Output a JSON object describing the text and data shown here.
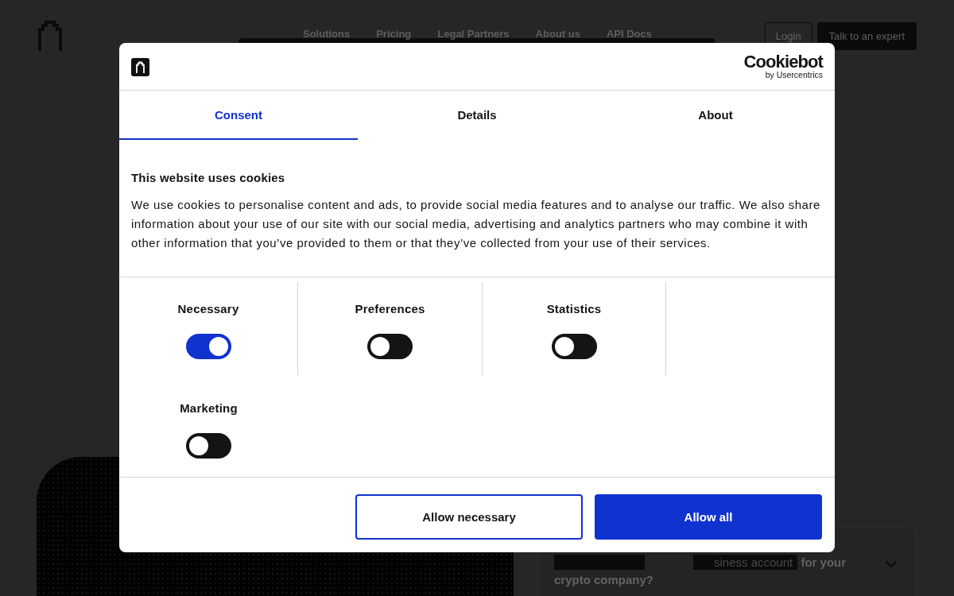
{
  "header": {
    "nav_links": [
      "Solutions",
      "Pricing",
      "Legal Partners",
      "About us",
      "API Docs"
    ],
    "login": "Login",
    "cta": "Talk to an expert"
  },
  "dialog": {
    "brand": "Cookiebot",
    "brand_byline": "by Usercentrics",
    "tabs": [
      {
        "label": "Consent",
        "selected": true
      },
      {
        "label": "Details",
        "selected": false
      },
      {
        "label": "About",
        "selected": false
      }
    ],
    "title": "This website uses cookies",
    "text": "We use cookies to personalise content and ads, to provide social media features and to analyse our traffic. We also share information about your use of our site with our social media, advertising and analytics partners who may combine it with other information that you’ve provided to them or that they’ve collected from your use of their services.",
    "categories": [
      {
        "label": "Necessary",
        "checked": true
      },
      {
        "label": "Preferences",
        "checked": false
      },
      {
        "label": "Statistics",
        "checked": false
      },
      {
        "label": "Marketing",
        "checked": false
      }
    ],
    "buttons": [
      {
        "label": "Allow necessary",
        "kind": "outline"
      },
      {
        "label": "Allow all",
        "kind": "primary"
      }
    ]
  },
  "faq": {
    "highlight": "siness account",
    "question": "for your crypto company?",
    "expanded": false
  }
}
